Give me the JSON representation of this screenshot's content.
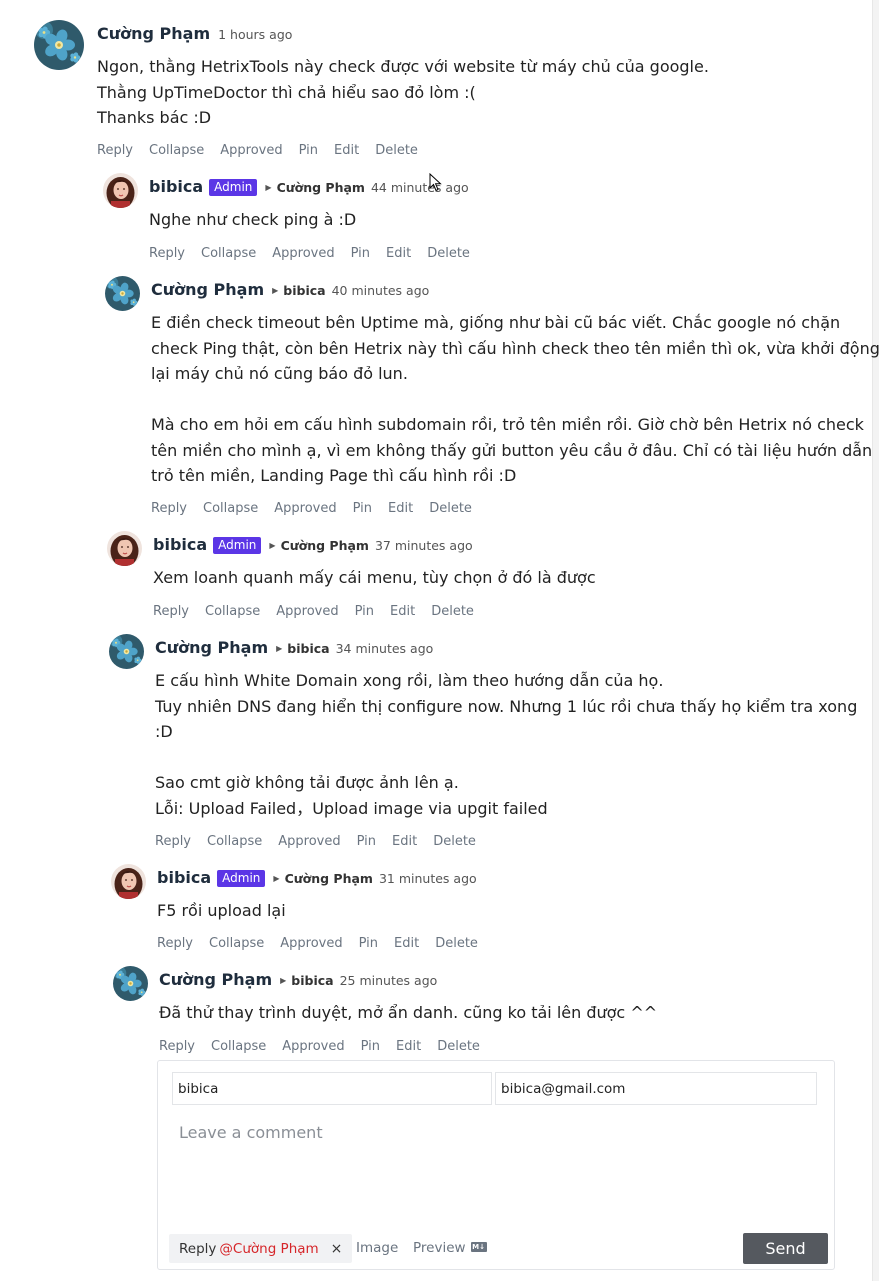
{
  "comments": [
    {
      "author": "Cường Phạm",
      "badge": "",
      "reply_to": "",
      "time": "1 hours ago",
      "text": "Ngon, thằng HetrixTools này check được với website từ máy chủ của google.\nThằng UpTimeDoctor thì chả hiểu sao đỏ lòm :(\nThanks bác :D",
      "avatar": "flower-avatar"
    },
    {
      "author": "bibica",
      "badge": "Admin",
      "reply_to": "Cường Phạm",
      "time": "44 minutes ago",
      "text": "Nghe như check ping à :D",
      "avatar": "girl-avatar"
    },
    {
      "author": "Cường Phạm",
      "badge": "",
      "reply_to": "bibica",
      "time": "40 minutes ago",
      "text": "E điền check timeout bên Uptime mà, giống như bài cũ bác viết. Chắc google nó chặn\ncheck Ping thật, còn bên Hetrix này thì cấu hình check theo tên miền thì ok, vừa khởi động\nlại máy chủ nó cũng báo đỏ lun.\n\nMà cho em hỏi em cấu hình subdomain rồi, trỏ tên miền rồi. Giờ chờ bên Hetrix nó check\ntên miền cho mình ạ, vì em không thấy gửi button yêu cầu ở đâu. Chỉ có tài liệu hướn dẫn\ntrỏ tên miền, Landing Page thì cấu hình rồi :D",
      "avatar": "flower-avatar"
    },
    {
      "author": "bibica",
      "badge": "Admin",
      "reply_to": "Cường Phạm",
      "time": "37 minutes ago",
      "text": "Xem loanh quanh mấy cái menu, tùy chọn ở đó là được",
      "avatar": "girl-avatar"
    },
    {
      "author": "Cường Phạm",
      "badge": "",
      "reply_to": "bibica",
      "time": "34 minutes ago",
      "text": "E cấu hình White Domain xong rồi, làm theo hướng dẫn của họ.\nTuy nhiên DNS đang hiển thị configure now. Nhưng 1 lúc rồi chưa thấy họ kiểm tra xong\n:D\n\nSao cmt giờ không tải được ảnh lên ạ.\nLỗi: Upload Failed，Upload image via upgit failed",
      "avatar": "flower-avatar"
    },
    {
      "author": "bibica",
      "badge": "Admin",
      "reply_to": "Cường Phạm",
      "time": "31 minutes ago",
      "text": "F5 rồi upload lại",
      "avatar": "girl-avatar"
    },
    {
      "author": "Cường Phạm",
      "badge": "",
      "reply_to": "bibica",
      "time": "25 minutes ago",
      "text": "Đã thử thay trình duyệt, mở ẩn danh. cũng ko tải lên được ^^",
      "avatar": "flower-avatar"
    }
  ],
  "actions": {
    "reply": "Reply",
    "collapse": "Collapse",
    "approved": "Approved",
    "pin": "Pin",
    "edit": "Edit",
    "delete": "Delete"
  },
  "editor": {
    "name_value": "bibica",
    "email_value": "bibica@gmail.com",
    "comment_placeholder": "Leave a comment",
    "reply_label": "Reply",
    "reply_target": "@Cường Phạm",
    "close_glyph": "×",
    "image_label": "Image",
    "preview_label": "Preview",
    "markdown_icon_text": "M↓",
    "send_label": "Send"
  },
  "colors": {
    "badge": "#5b36e6",
    "reply_target": "#d6262a",
    "send_button": "#55595f"
  }
}
